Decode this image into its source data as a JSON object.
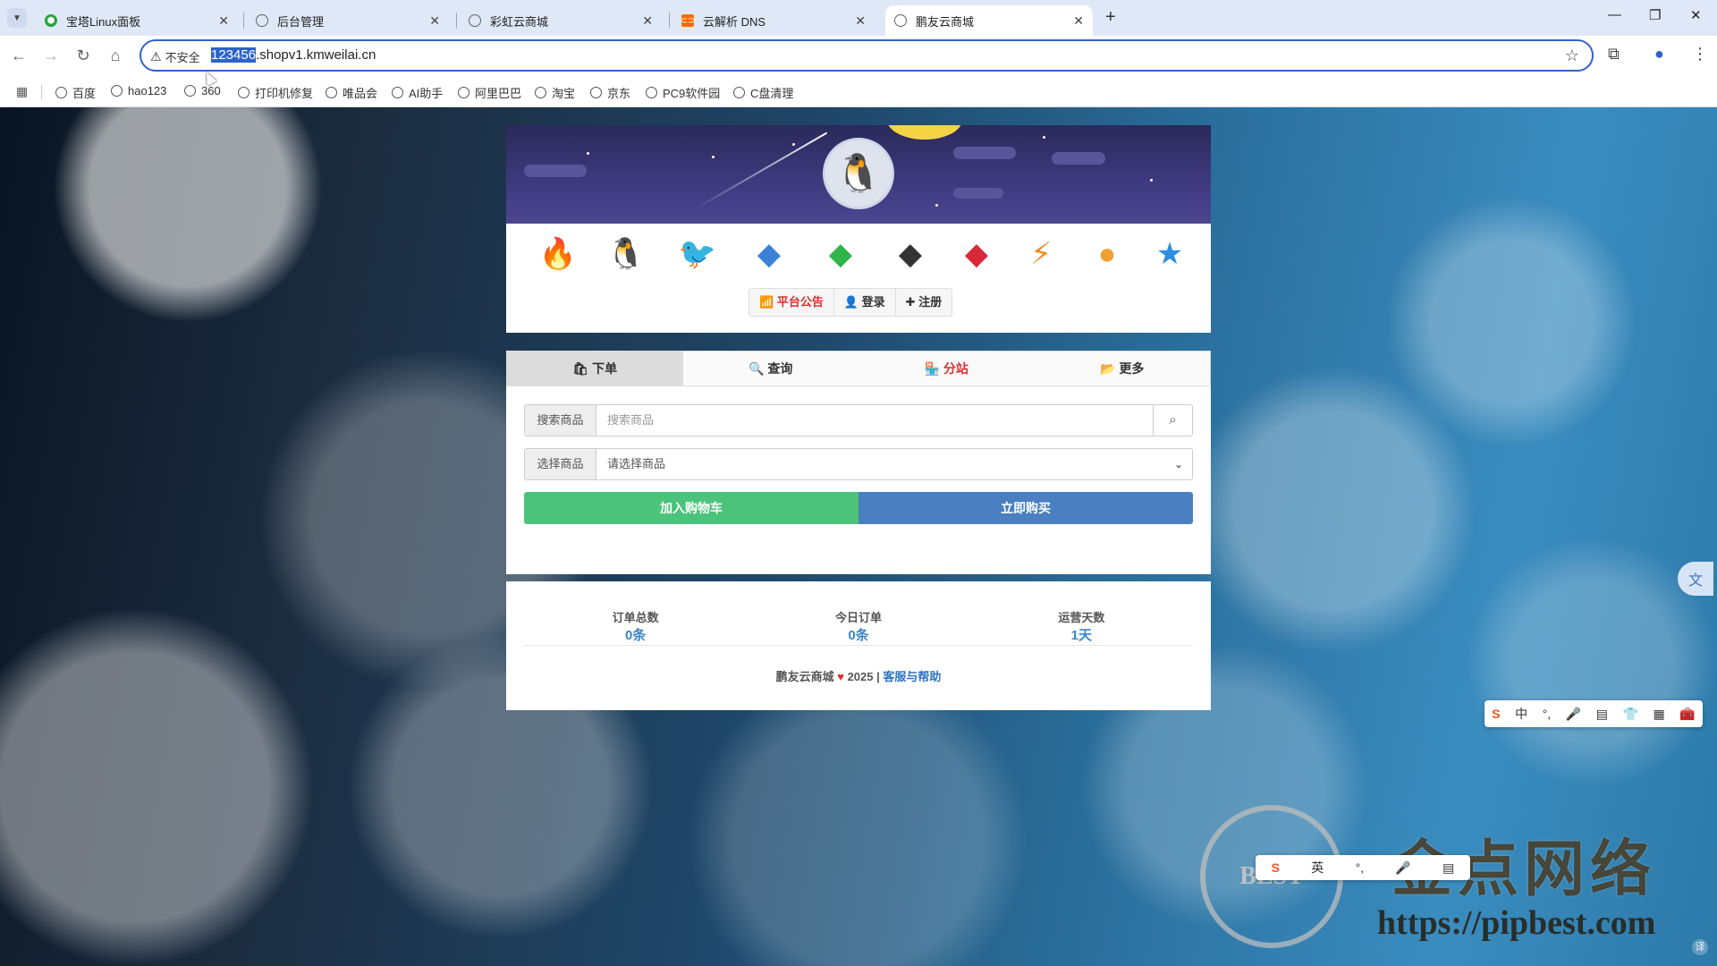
{
  "browser": {
    "tabs": [
      {
        "label": "宝塔Linux面板",
        "fav_color": "#20a53a",
        "fav_icon": "shield-icon"
      },
      {
        "label": "后台管理",
        "fav_color": "#5f6368",
        "fav_icon": "globe-icon"
      },
      {
        "label": "彩虹云商城",
        "fav_color": "#5f6368",
        "fav_icon": "globe-icon"
      },
      {
        "label": "云解析 DNS",
        "fav_color": "#ff6a00",
        "fav_icon": "aliyun-icon"
      },
      {
        "label": "鹏友云商城",
        "fav_color": "#5f6368",
        "fav_icon": "globe-icon"
      }
    ],
    "new_tab": "+",
    "omnibox": {
      "security_label": "不安全",
      "url_selected": "123456",
      "url_rest": ".shopv1.kmweilai.cn"
    },
    "bookmarks": [
      "百度",
      "hao123",
      "360",
      "打印机修复",
      "唯品会",
      "AI助手",
      "阿里巴巴",
      "淘宝",
      "京东",
      "PC9软件园",
      "C盘清理"
    ]
  },
  "site": {
    "top_buttons": {
      "notice": "平台公告",
      "login": "登录",
      "register": "注册"
    },
    "grade_icons": [
      "flame-badge-icon",
      "penguin-icon",
      "red-penguin-icon",
      "blue-diamond-icon",
      "green-diamond-icon",
      "black-diamond-icon",
      "red-diamond-icon",
      "lightning-badge-icon",
      "orange-coin-icon",
      "blue-star-icon"
    ],
    "tabs": {
      "order": "下单",
      "query": "查询",
      "substation": "分站",
      "more": "更多"
    },
    "search": {
      "label": "搜索商品",
      "placeholder": "搜索商品"
    },
    "select": {
      "label": "选择商品",
      "value": "请选择商品"
    },
    "buttons": {
      "add_cart": "加入购物车",
      "buy_now": "立即购买"
    },
    "stats": [
      {
        "label": "订单总数",
        "value": "0条"
      },
      {
        "label": "今日订单",
        "value": "0条"
      },
      {
        "label": "运营天数",
        "value": "1天"
      }
    ],
    "footer": {
      "brand": "鹏友云商城",
      "year": "2025 |",
      "help_link": "客服与帮助"
    }
  },
  "overlays": {
    "ime_main": [
      "中",
      "°,",
      "🎤",
      "▤",
      "👕",
      "▦",
      "🧰"
    ],
    "ime_secondary": [
      "英",
      "°,",
      "🎤",
      "▤"
    ],
    "watermark_title": "金点网络",
    "watermark_url": "https://pipbest.com",
    "watermark_badge": "BEST"
  },
  "colors": {
    "accent_blue": "#2e64c8",
    "danger_red": "#d9312e",
    "success_green": "#4cc37a",
    "primary_blue": "#4a7fc1"
  }
}
